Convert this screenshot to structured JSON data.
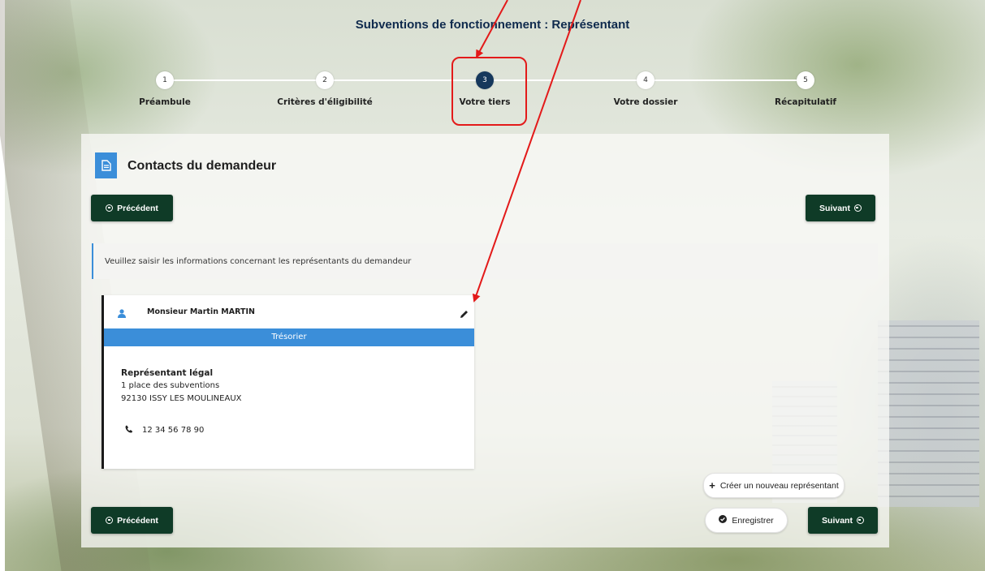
{
  "page": {
    "title": "Subventions de fonctionnement : Représentant"
  },
  "stepper": {
    "steps": [
      {
        "number": "1",
        "label": "Préambule"
      },
      {
        "number": "2",
        "label": "Critères d'éligibilité"
      },
      {
        "number": "3",
        "label": "Votre tiers"
      },
      {
        "number": "4",
        "label": "Votre dossier"
      },
      {
        "number": "5",
        "label": "Récapitulatif"
      }
    ],
    "active_step": 3
  },
  "section": {
    "title": "Contacts du demandeur",
    "icon": "document-icon"
  },
  "nav": {
    "previous_label": "Précédent",
    "next_label": "Suivant",
    "save_label": "Enregistrer",
    "create_label": "Créer un nouveau représentant"
  },
  "info": {
    "text": "Veuillez saisir les informations concernant les représentants du demandeur"
  },
  "contact": {
    "name": "Monsieur Martin MARTIN",
    "role": "Trésorier",
    "qualification": "Représentant légal",
    "address_line1": "1 place des subventions",
    "address_line2": "92130 ISSY LES MOULINEAUX",
    "phone": "12 34 56 78 90"
  },
  "colors": {
    "primary_dark": "#0f3b27",
    "accent_blue": "#3b8ed9",
    "active_step": "#16385c",
    "annotation_red": "#e31a1a"
  }
}
